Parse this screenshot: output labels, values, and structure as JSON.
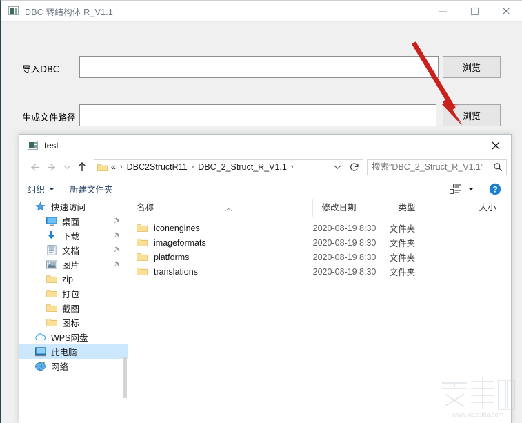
{
  "app": {
    "title": "DBC 转结构体 R_V1.1",
    "icon": "app-icon",
    "window_buttons": [
      {
        "name": "minimize-button",
        "glyph": "minimize"
      },
      {
        "name": "maximize-button",
        "glyph": "maximize"
      },
      {
        "name": "close-button",
        "glyph": "close"
      }
    ],
    "form": {
      "import_label": "导入DBC",
      "import_value": "",
      "import_placeholder": "",
      "output_label": "生成文件路径",
      "output_value": "",
      "output_placeholder": "",
      "browse_label_1": "浏览",
      "browse_label_2": "浏览"
    },
    "annotation": {
      "type": "red-arrow",
      "color": "#c9211e",
      "points_to": "浏览"
    }
  },
  "dialog": {
    "title": "test",
    "close_label": "✕",
    "nav": {
      "back": "back-arrow",
      "forward": "forward-arrow",
      "recent": "recent-locations-chevron",
      "up": "up-arrow",
      "breadcrumbs": [
        "«",
        "DBC2StructR11",
        "DBC_2_Struct_R_V1.1"
      ],
      "separator": "›",
      "refresh": "refresh-icon",
      "dropdown": "address-chevron-icon"
    },
    "search": {
      "placeholder": "搜索\"DBC_2_Struct_R_V1.1\"",
      "value": "",
      "icon": "search-icon"
    },
    "toolbar": {
      "organize": "组织",
      "new_folder": "新建文件夹",
      "view_icon": "view-layout-icon",
      "help_icon": "help-icon"
    },
    "sidebar": [
      {
        "label": "快速访问",
        "icon": "star-icon",
        "level": "root",
        "pinned": false,
        "selected": false
      },
      {
        "label": "桌面",
        "icon": "desktop-icon",
        "level": "child",
        "pinned": true,
        "selected": false
      },
      {
        "label": "下载",
        "icon": "download-icon",
        "level": "child",
        "pinned": true,
        "selected": false
      },
      {
        "label": "文档",
        "icon": "documents-icon",
        "level": "child",
        "pinned": true,
        "selected": false
      },
      {
        "label": "图片",
        "icon": "pictures-icon",
        "level": "child",
        "pinned": true,
        "selected": false
      },
      {
        "label": "zip",
        "icon": "folder-icon",
        "level": "child",
        "pinned": false,
        "selected": false
      },
      {
        "label": "打包",
        "icon": "folder-icon",
        "level": "child",
        "pinned": false,
        "selected": false
      },
      {
        "label": "截图",
        "icon": "folder-icon",
        "level": "child",
        "pinned": false,
        "selected": false
      },
      {
        "label": "图标",
        "icon": "folder-icon",
        "level": "child",
        "pinned": false,
        "selected": false
      },
      {
        "label": "WPS网盘",
        "icon": "cloud-icon",
        "level": "root",
        "pinned": false,
        "selected": false
      },
      {
        "label": "此电脑",
        "icon": "computer-icon",
        "level": "root",
        "pinned": false,
        "selected": true
      },
      {
        "label": "网络",
        "icon": "network-icon",
        "level": "root",
        "pinned": false,
        "selected": false
      }
    ],
    "columns": [
      {
        "label": "名称",
        "sorted": "asc"
      },
      {
        "label": "修改日期",
        "sorted": ""
      },
      {
        "label": "类型",
        "sorted": ""
      },
      {
        "label": "大小",
        "sorted": ""
      }
    ],
    "files": [
      {
        "name": "iconengines",
        "date": "2020-08-19 8:30",
        "type": "文件夹",
        "size": ""
      },
      {
        "name": "imageformats",
        "date": "2020-08-19 8:30",
        "type": "文件夹",
        "size": ""
      },
      {
        "name": "platforms",
        "date": "2020-08-19 8:30",
        "type": "文件夹",
        "size": ""
      },
      {
        "name": "translations",
        "date": "2020-08-19 8:30",
        "type": "文件夹",
        "size": ""
      }
    ]
  },
  "watermark": {
    "text": "下载吧",
    "url": "www.xiazaiba.com"
  }
}
